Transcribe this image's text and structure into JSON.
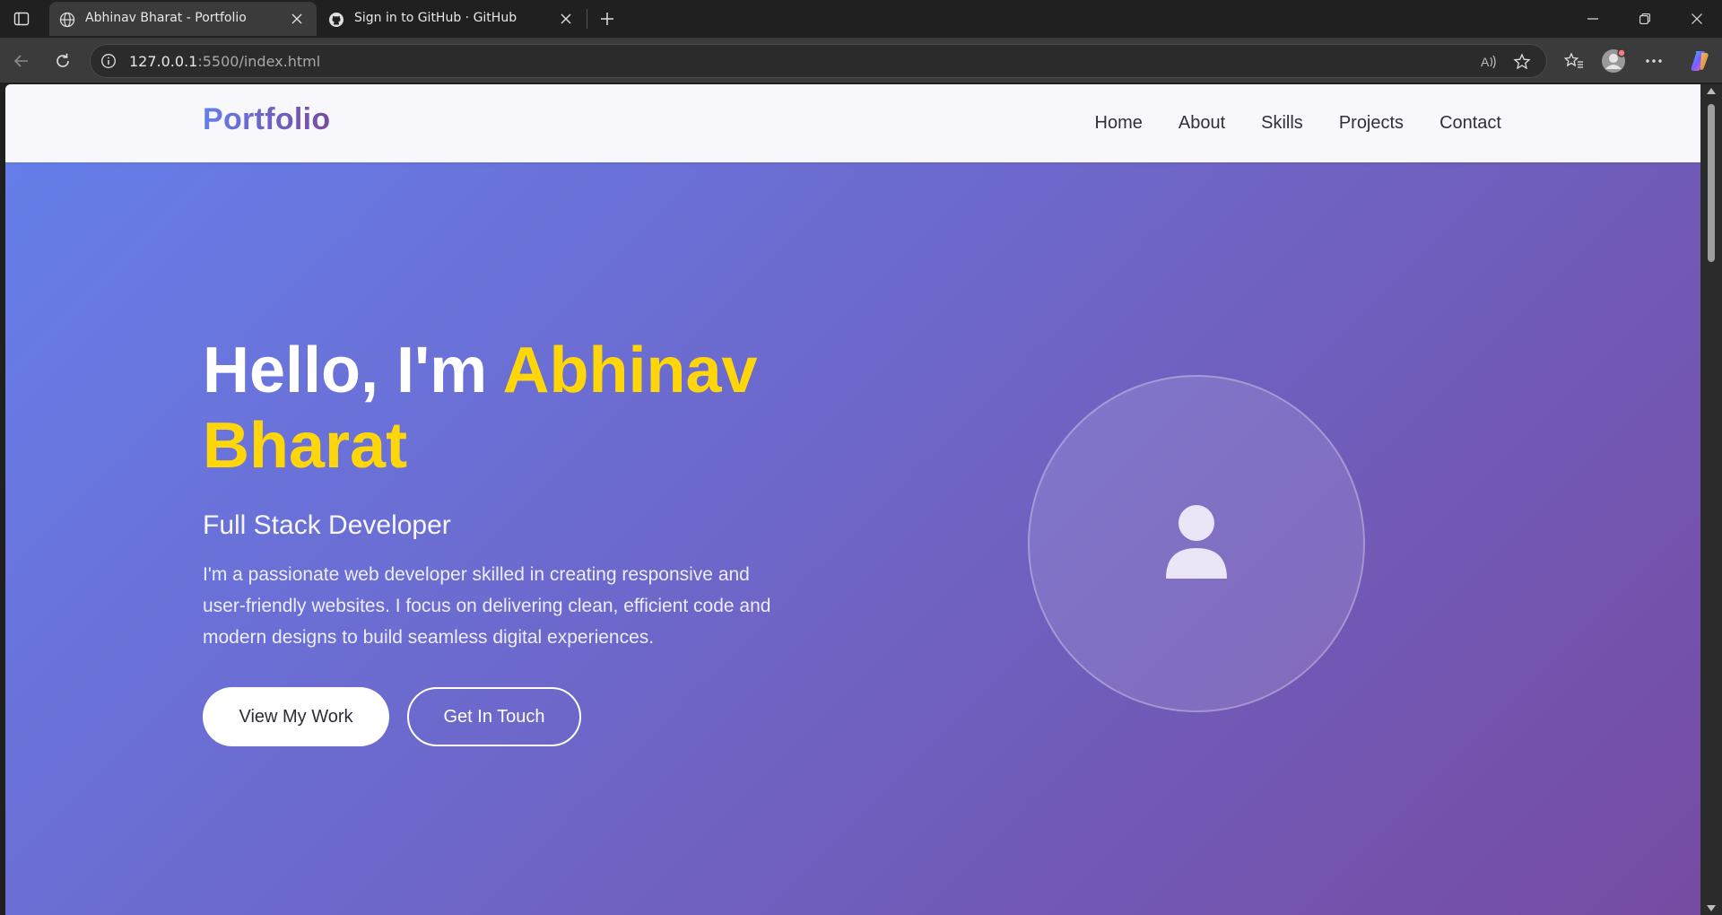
{
  "browser": {
    "tabs": [
      {
        "title": "Abhinav Bharat - Portfolio",
        "icon": "globe-icon",
        "active": true
      },
      {
        "title": "Sign in to GitHub · GitHub",
        "icon": "github-icon",
        "active": false
      }
    ],
    "address": {
      "host": "127.0.0.1",
      "port_path": ":5500/index.html"
    }
  },
  "navbar": {
    "logo": "Portfolio",
    "links": [
      "Home",
      "About",
      "Skills",
      "Projects",
      "Contact"
    ]
  },
  "hero": {
    "greeting": "Hello, I'm ",
    "name": "Abhinav Bharat",
    "subtitle": "Full Stack Developer",
    "description": "I'm a passionate web developer skilled in creating responsive and user-friendly websites. I focus on delivering clean, efficient code and modern designs to build seamless digital experiences.",
    "primary_button": "View My Work",
    "secondary_button": "Get In Touch",
    "avatar_icon": "user-icon"
  },
  "colors": {
    "gradient_start": "#667eea",
    "gradient_end": "#764ba2",
    "name_highlight": "#ffd60a"
  }
}
